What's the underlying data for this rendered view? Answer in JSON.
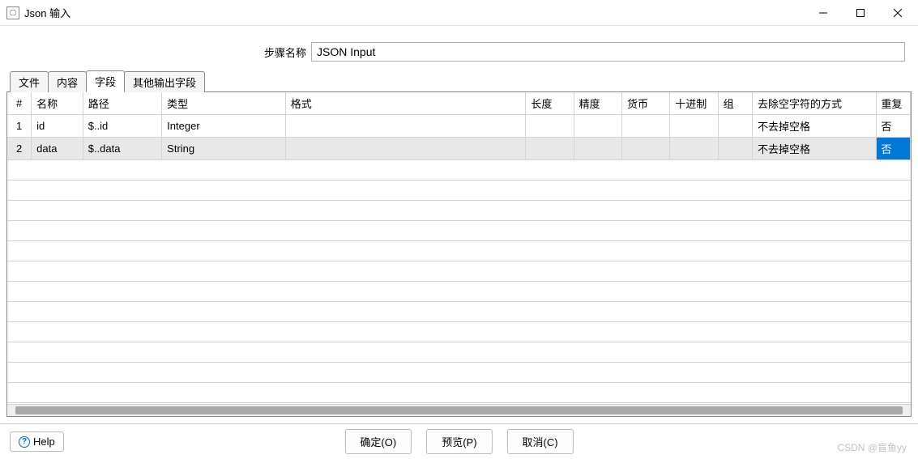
{
  "window": {
    "title": "Json 输入",
    "icon_label": "app-icon"
  },
  "step": {
    "label": "步骤名称",
    "value": "JSON Input"
  },
  "tabs": [
    {
      "label": "文件",
      "active": false
    },
    {
      "label": "内容",
      "active": false
    },
    {
      "label": "字段",
      "active": true
    },
    {
      "label": "其他输出字段",
      "active": false
    }
  ],
  "table": {
    "headers": {
      "num": "#",
      "name": "名称",
      "path": "路径",
      "type": "类型",
      "format": "格式",
      "length": "长度",
      "precision": "精度",
      "currency": "货币",
      "decimal": "十进制",
      "group": "组",
      "trim": "去除空字符的方式",
      "repeat": "重复"
    },
    "rows": [
      {
        "num": "1",
        "name": "id",
        "path": "$..id",
        "type": "Integer",
        "format": "",
        "length": "",
        "precision": "",
        "currency": "",
        "decimal": "",
        "group": "",
        "trim": "不去掉空格",
        "repeat": "否"
      },
      {
        "num": "2",
        "name": "data",
        "path": "$..data",
        "type": "String",
        "format": "",
        "length": "",
        "precision": "",
        "currency": "",
        "decimal": "",
        "group": "",
        "trim": "不去掉空格",
        "repeat": "否"
      }
    ]
  },
  "buttons": {
    "ok": "确定(O)",
    "preview": "预览(P)",
    "cancel": "取消(C)",
    "help": "Help"
  },
  "watermark": "CSDN @盲鱼yy"
}
